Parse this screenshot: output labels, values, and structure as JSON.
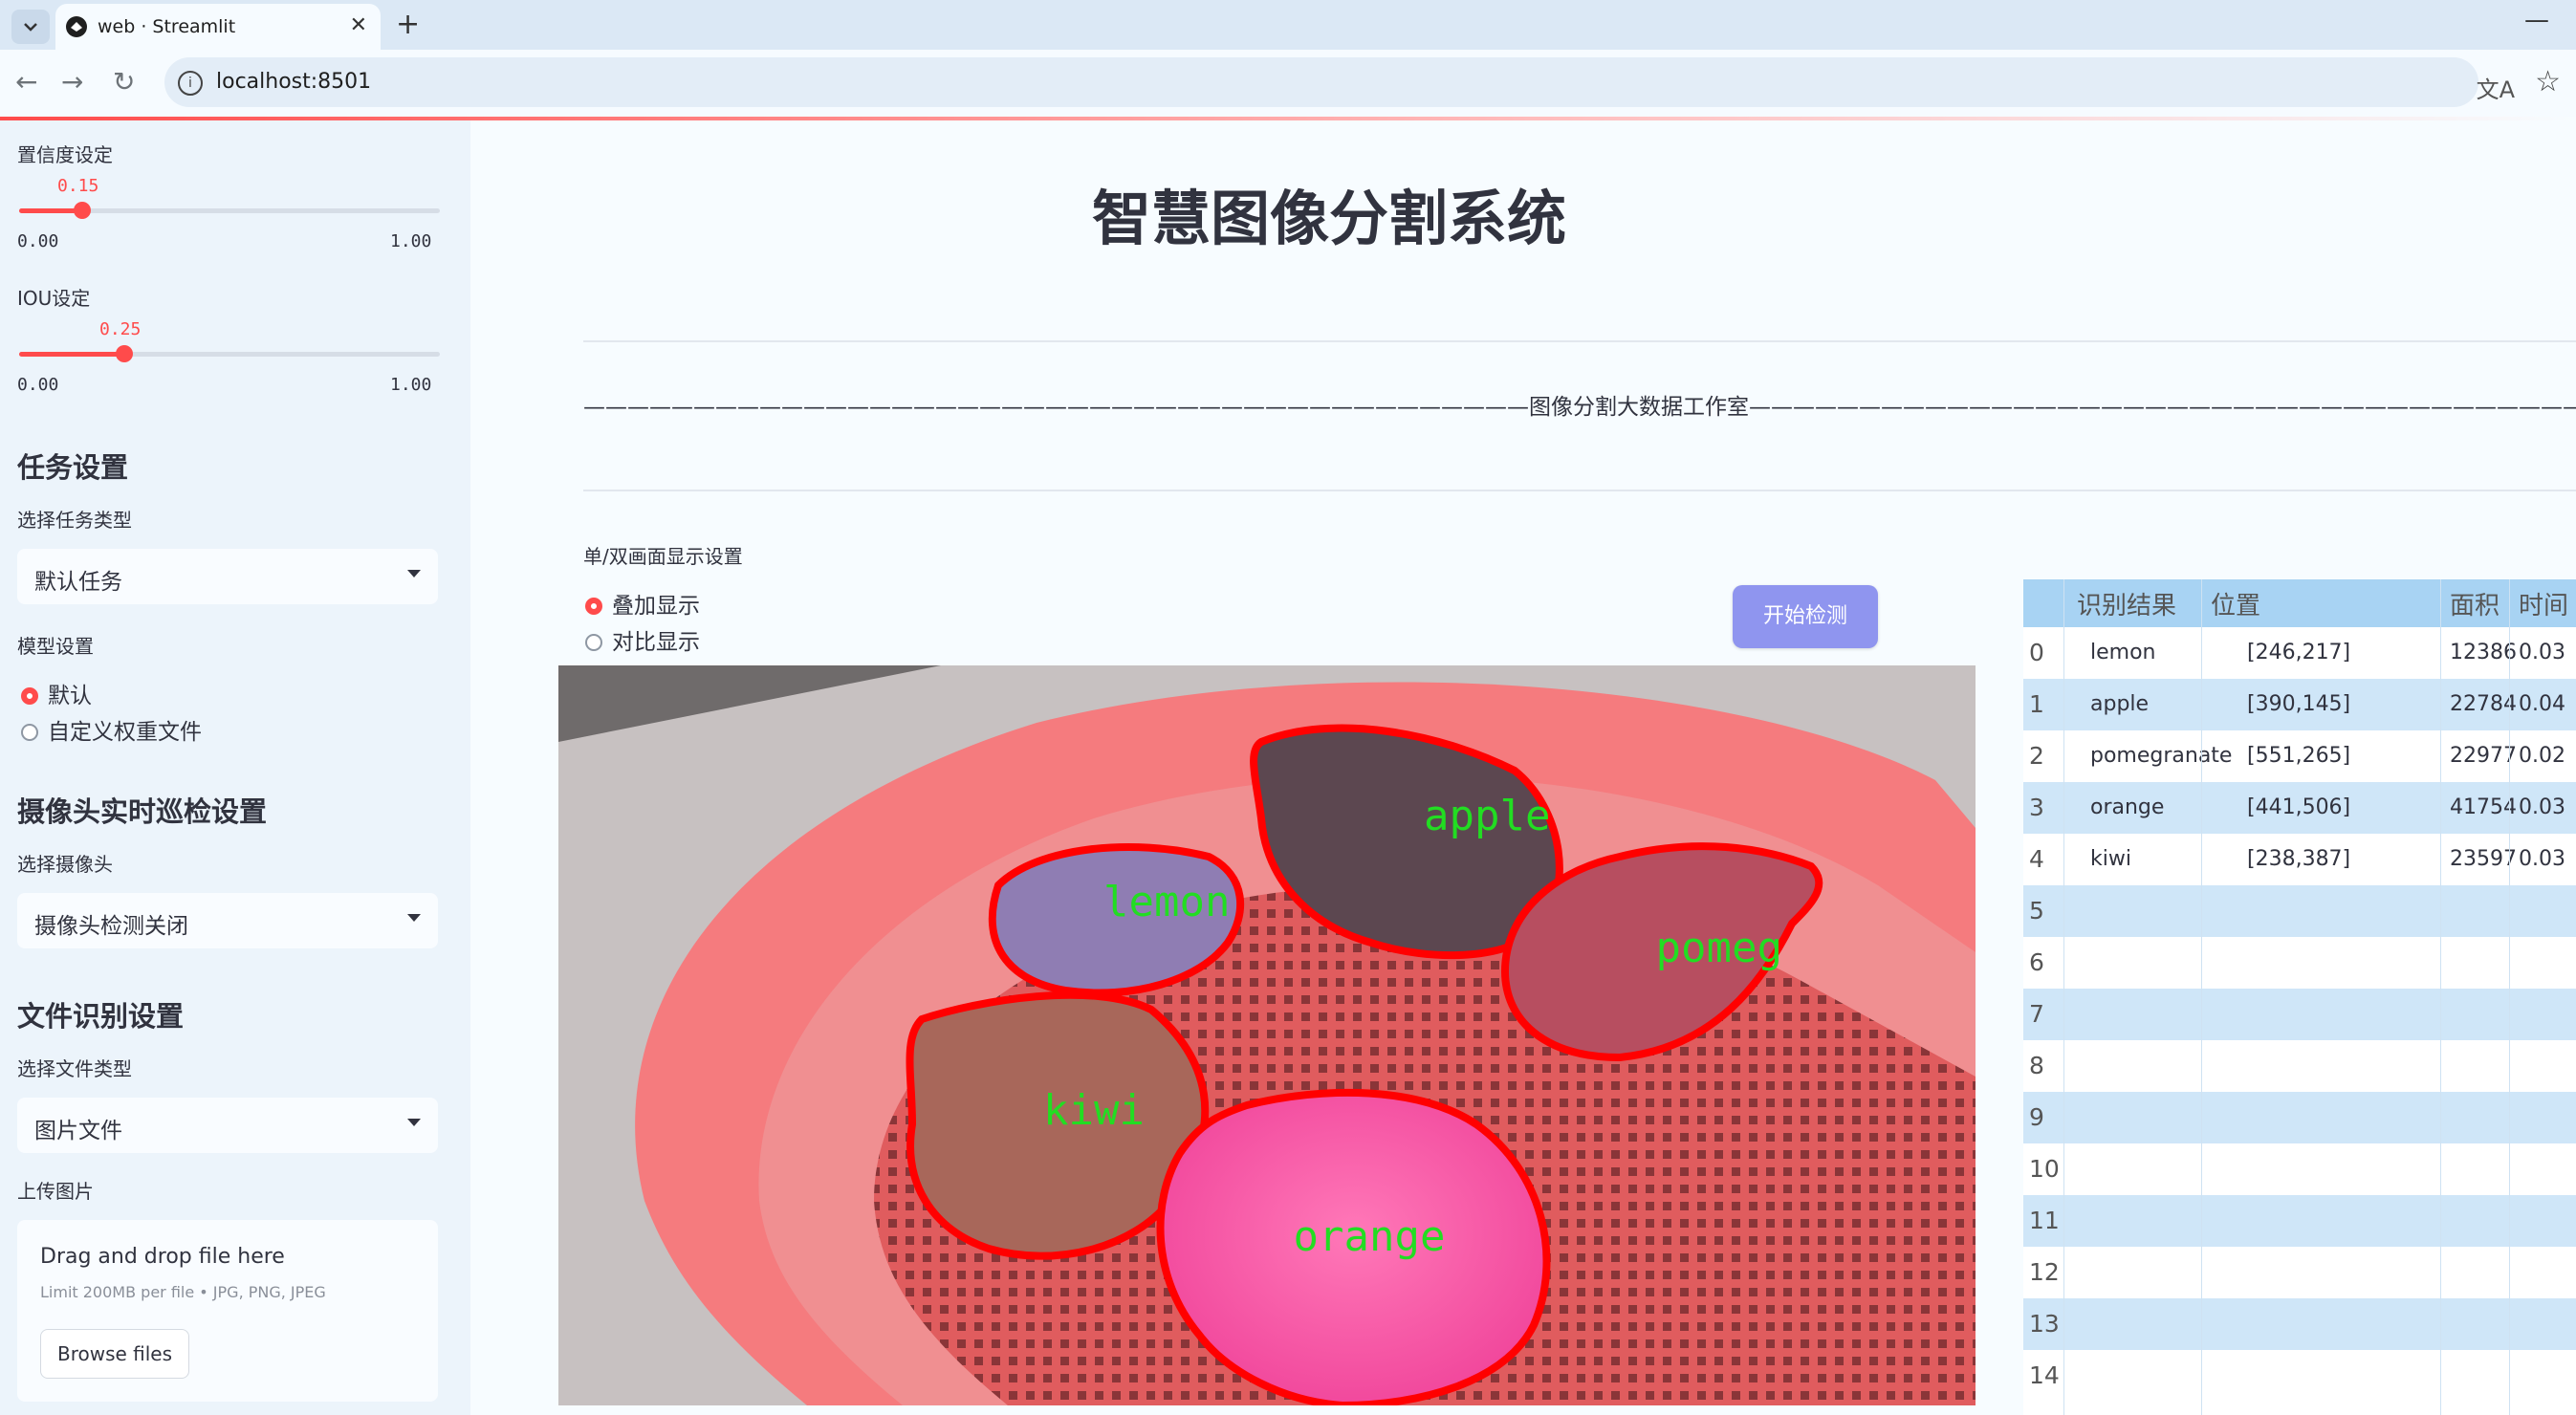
{
  "browser": {
    "tab_title": "web · Streamlit",
    "url": "localhost:8501"
  },
  "sidebar": {
    "confidence": {
      "label": "置信度设定",
      "value": "0.15",
      "min": "0.00",
      "max": "1.00",
      "fraction": 0.15
    },
    "iou": {
      "label": "IOU设定",
      "value": "0.25",
      "min": "0.00",
      "max": "1.00",
      "fraction": 0.25
    },
    "task_header": "任务设置",
    "task_type_label": "选择任务类型",
    "task_type_value": "默认任务",
    "model_label": "模型设置",
    "model_options": [
      "默认",
      "自定义权重文件"
    ],
    "model_selected": 0,
    "camera_header": "摄像头实时巡检设置",
    "camera_label": "选择摄像头",
    "camera_value": "摄像头检测关闭",
    "file_header": "文件识别设置",
    "file_type_label": "选择文件类型",
    "file_type_value": "图片文件",
    "upload_label": "上传图片",
    "upload_drag": "Drag and drop file here",
    "upload_limit": "Limit 200MB per file • JPG, PNG, JPEG",
    "upload_button": "Browse files"
  },
  "main": {
    "title": "智慧图像分割系统",
    "studio_line": "———————————————————————————————————————————图像分割大数据工作室———————————————————————————————————————————",
    "display_label": "单/双画面显示设置",
    "display_options": [
      "叠加显示",
      "对比显示"
    ],
    "display_selected": 0,
    "detect_button": "开始检测",
    "image_labels": [
      "apple",
      "lemon",
      "pomeg",
      "kiwi",
      "orange"
    ]
  },
  "table": {
    "columns": [
      "识别结果",
      "位置",
      "面积",
      "时间"
    ],
    "rows": [
      {
        "idx": "0",
        "result": "lemon",
        "pos": "[246,217]",
        "area": "12386",
        "time": "0.03"
      },
      {
        "idx": "1",
        "result": "apple",
        "pos": "[390,145]",
        "area": "22784",
        "time": "0.04"
      },
      {
        "idx": "2",
        "result": "pomegranate",
        "pos": "[551,265]",
        "area": "22977",
        "time": "0.02"
      },
      {
        "idx": "3",
        "result": "orange",
        "pos": "[441,506]",
        "area": "41754",
        "time": "0.03"
      },
      {
        "idx": "4",
        "result": "kiwi",
        "pos": "[238,387]",
        "area": "23597",
        "time": "0.03"
      },
      {
        "idx": "5"
      },
      {
        "idx": "6"
      },
      {
        "idx": "7"
      },
      {
        "idx": "8"
      },
      {
        "idx": "9"
      },
      {
        "idx": "10"
      },
      {
        "idx": "11"
      },
      {
        "idx": "12"
      },
      {
        "idx": "13"
      },
      {
        "idx": "14"
      }
    ]
  },
  "colors": {
    "accent": "#ff4b4b",
    "button": "#8f95ef",
    "table_header": "#a8d3f3",
    "mask_outline": "#ff0000",
    "mask_label": "#22dd22"
  }
}
